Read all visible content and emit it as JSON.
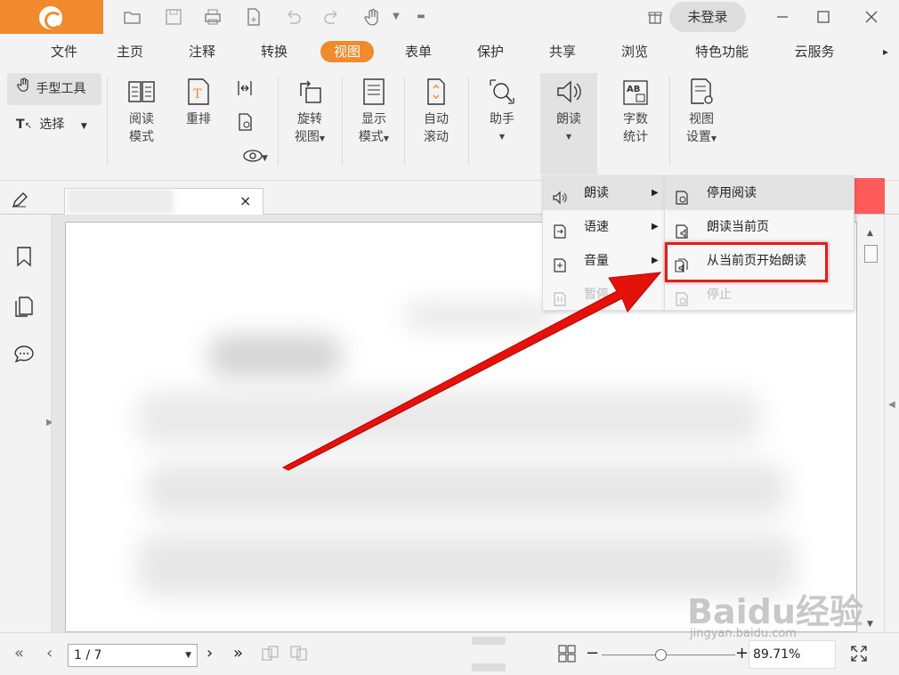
{
  "titlebar": {
    "login_label": "未登录",
    "quick_access": [
      "open-folder-icon",
      "save-icon",
      "print-icon",
      "new-doc-icon",
      "undo-icon",
      "redo-icon",
      "hand-icon",
      "dropdown-icon",
      "customize-icon"
    ]
  },
  "menubar": {
    "items": [
      "文件",
      "主页",
      "注释",
      "转换",
      "视图",
      "表单",
      "保护",
      "共享",
      "浏览",
      "特色功能",
      "云服务"
    ],
    "active": "视图"
  },
  "ribbon": {
    "hand_tool": "手型工具",
    "select_tool": "选择",
    "read_mode": [
      "阅读",
      "模式"
    ],
    "reflow": "重排",
    "rotate_view": [
      "旋转",
      "视图"
    ],
    "display_mode": [
      "显示",
      "模式"
    ],
    "auto_scroll": [
      "自动",
      "滚动"
    ],
    "assistant": "助手",
    "read_aloud": "朗读",
    "word_count": [
      "字数",
      "统计"
    ],
    "view_settings": [
      "视图",
      "设置"
    ]
  },
  "tab": {
    "close": "×"
  },
  "readaloud_menu": {
    "items": [
      {
        "label": "朗读",
        "has_sub": true,
        "enabled": true,
        "highlighted": true
      },
      {
        "label": "语速",
        "has_sub": true,
        "enabled": true,
        "highlighted": false
      },
      {
        "label": "音量",
        "has_sub": true,
        "enabled": true,
        "highlighted": false
      },
      {
        "label": "暂停",
        "has_sub": false,
        "enabled": false,
        "highlighted": false
      }
    ]
  },
  "readaloud_submenu": {
    "items": [
      {
        "label": "停用阅读",
        "enabled": true
      },
      {
        "label": "朗读当前页",
        "enabled": true
      },
      {
        "label": "从当前页开始朗读",
        "enabled": true,
        "callout": true
      },
      {
        "label": "停止",
        "enabled": false
      }
    ]
  },
  "statusbar": {
    "page_value": "1 / 7",
    "zoom_value": "89.71%",
    "zoom_level": 0.43
  },
  "watermark": {
    "brand": "Baidu经验",
    "url": "jingyan.baidu.com"
  },
  "colors": {
    "accent": "#f08a2c",
    "callout_red": "#d9231b",
    "arrow_red": "#e3120b"
  }
}
